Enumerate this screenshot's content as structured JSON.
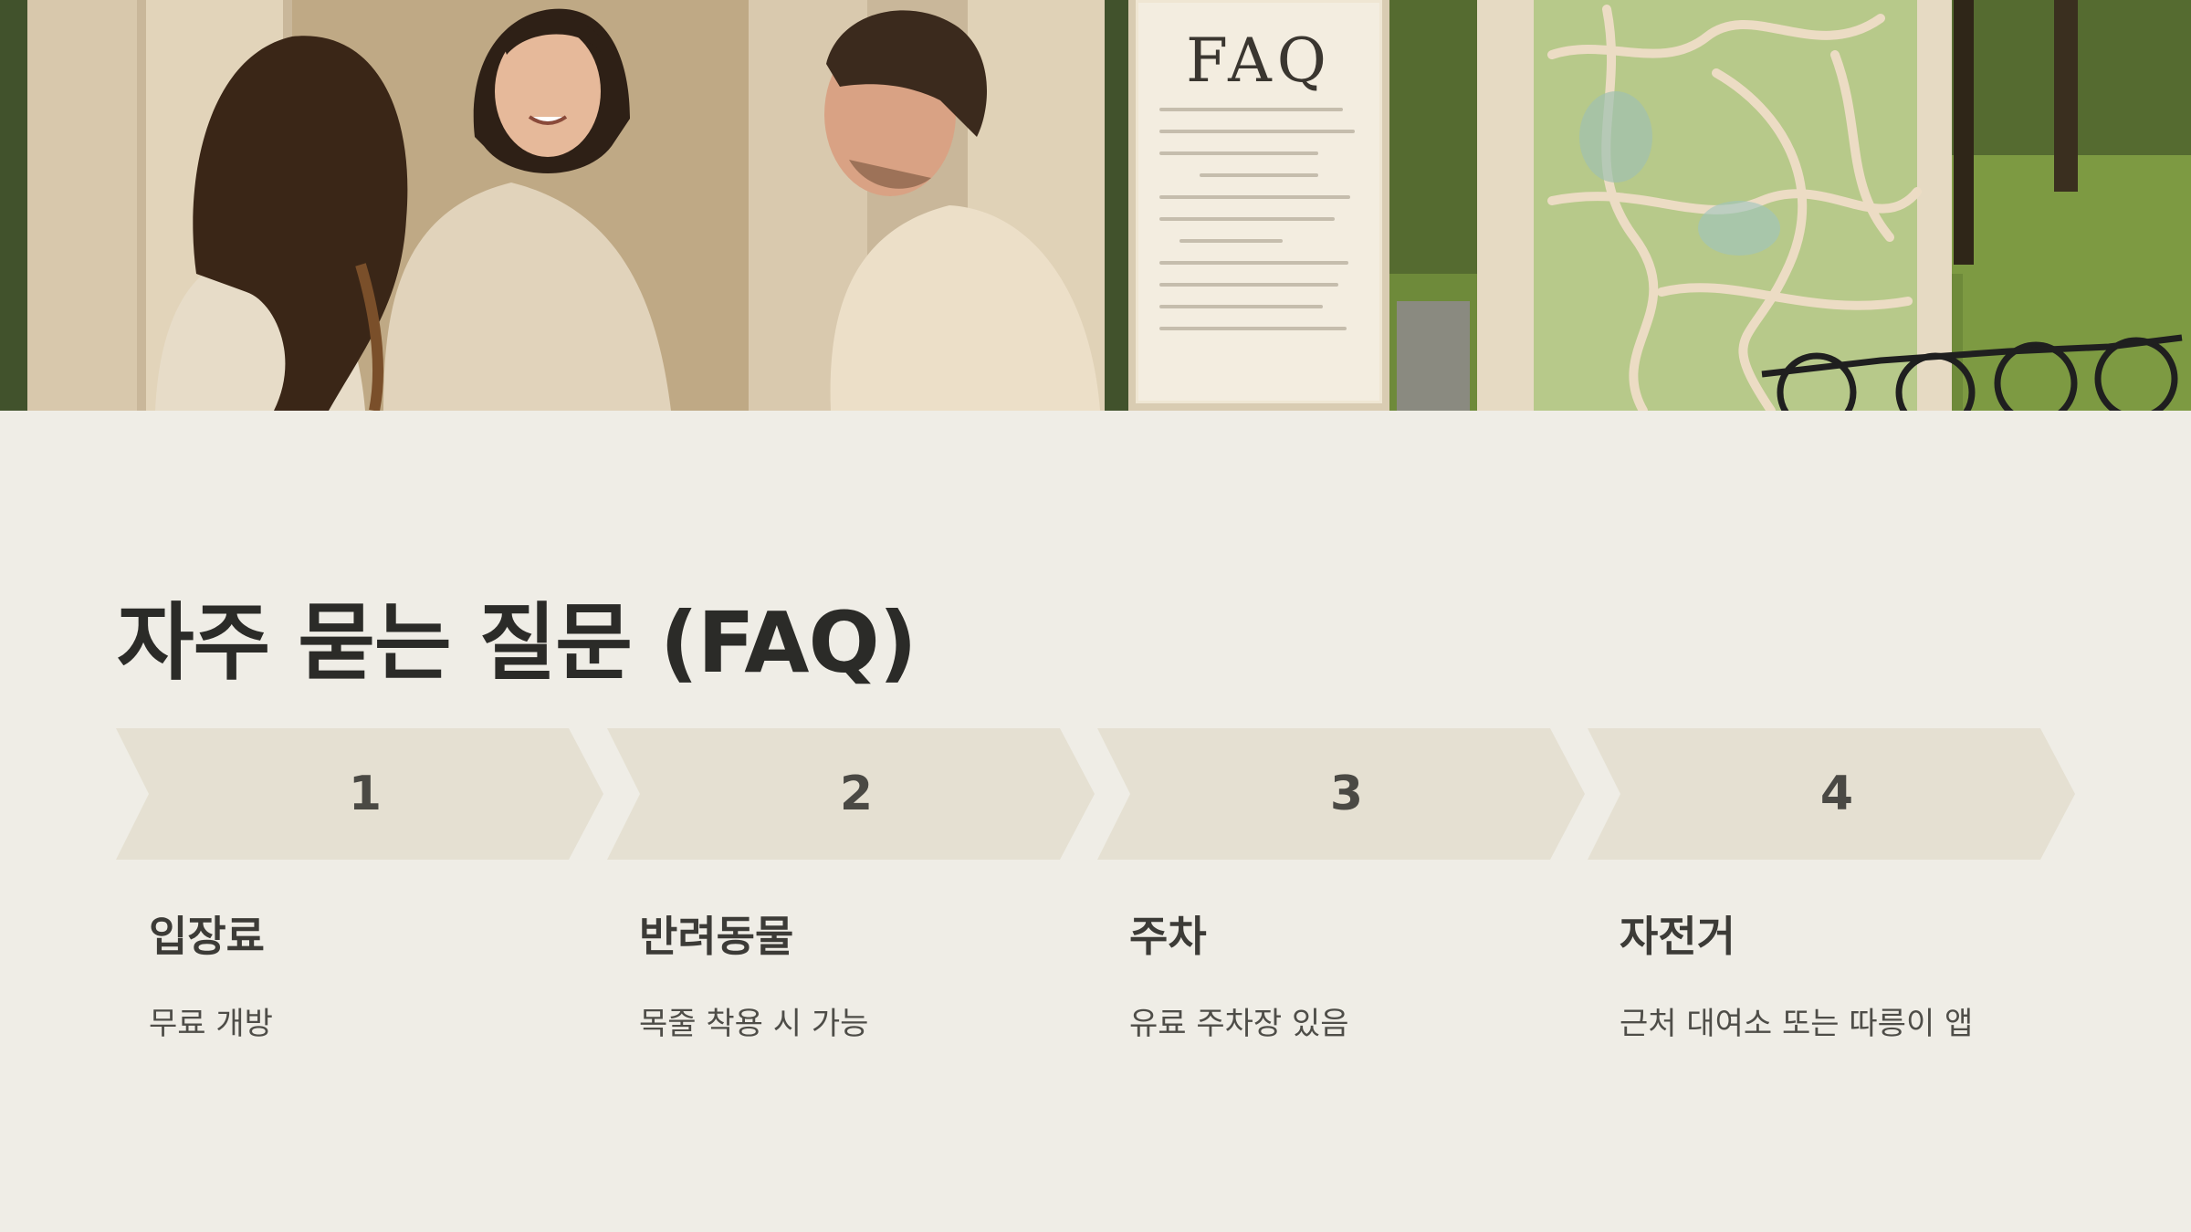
{
  "hero": {
    "board_title": "FAQ",
    "image_alt": "공원 안내소에서 대화하는 방문객들과 FAQ 안내판, 지도"
  },
  "title": "자주 묻는 질문 (FAQ)",
  "steps": [
    {
      "number": "1",
      "heading": "입장료",
      "description": "무료 개방"
    },
    {
      "number": "2",
      "heading": "반려동물",
      "description": "목줄 착용 시 가능"
    },
    {
      "number": "3",
      "heading": "주차",
      "description": "유료 주차장 있음"
    },
    {
      "number": "4",
      "heading": "자전거",
      "description": "근처 대여소 또는 따릉이 앱"
    }
  ],
  "colors": {
    "background": "#efede6",
    "chevron": "#e5e0d2",
    "title_text": "#2b2b28",
    "body_text": "#4e4d48"
  }
}
